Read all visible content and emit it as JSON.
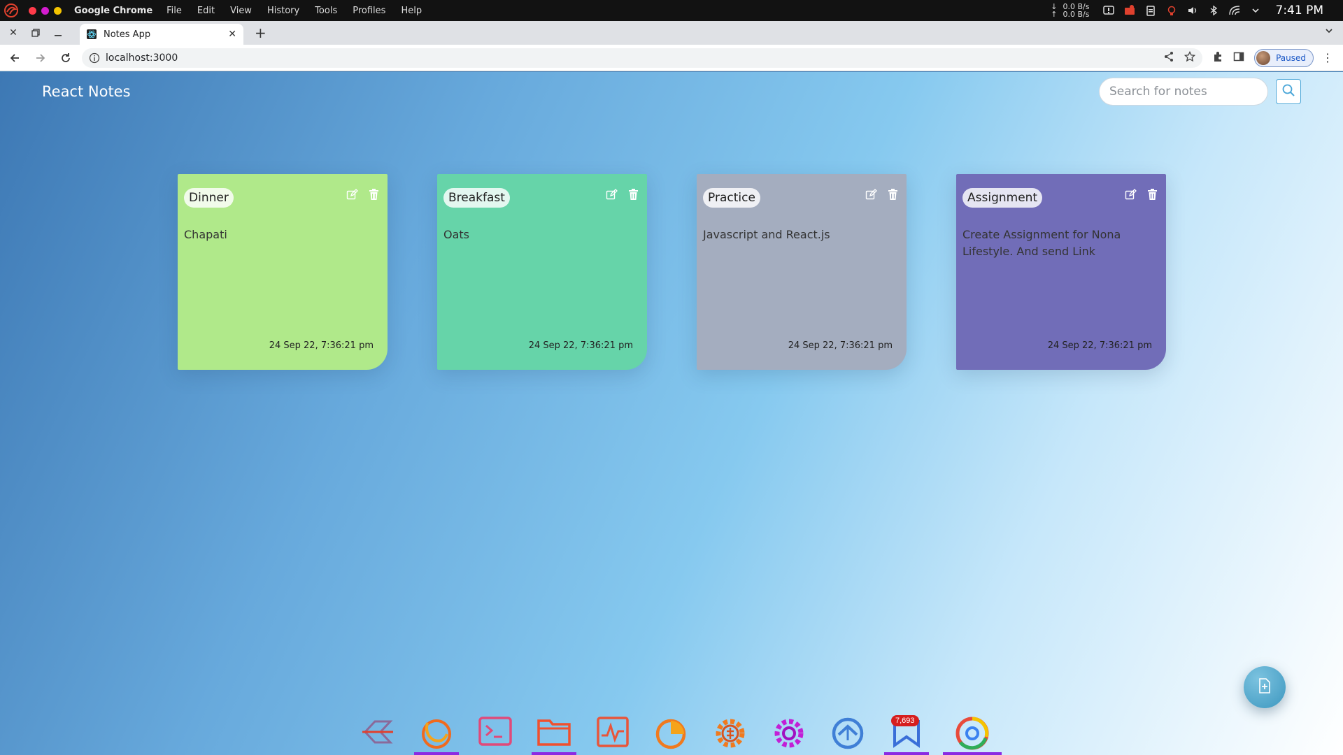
{
  "os": {
    "app_name": "Google Chrome",
    "menu": [
      "File",
      "Edit",
      "View",
      "History",
      "Tools",
      "Profiles",
      "Help"
    ],
    "net_down": "0.0 B/s",
    "net_up": "0.0 B/s",
    "clock": "7:41 PM"
  },
  "browser": {
    "tab_title": "Notes App",
    "url": "localhost:3000",
    "profile_status": "Paused"
  },
  "app": {
    "title": "React Notes",
    "search_placeholder": "Search for notes"
  },
  "notes": [
    {
      "title": "Dinner",
      "body": "Chapati",
      "date": "24 Sep 22, 7:36:21 pm",
      "color": "#b0e98a"
    },
    {
      "title": "Breakfast",
      "body": "Oats",
      "date": "24 Sep 22, 7:36:21 pm",
      "color": "#66d4a9"
    },
    {
      "title": "Practice",
      "body": "Javascript and React.js",
      "date": "24 Sep 22, 7:36:21 pm",
      "color": "#a4adbf"
    },
    {
      "title": "Assignment",
      "body": "Create Assignment for Nona Lifestyle. And send Link",
      "date": "24 Sep 22, 7:36:21 pm",
      "color": "#716db8"
    }
  ],
  "dock": {
    "items": [
      "zorin-icon",
      "firefox-icon",
      "terminal-icon",
      "files-icon",
      "system-monitor-icon",
      "disk-usage-icon",
      "settings-gear-icon",
      "tweaks-icon",
      "timeshift-icon",
      "bookmarks-icon",
      "chrome-icon"
    ],
    "badge": "7,693"
  },
  "colors": {
    "accent": "#4aa6d8",
    "indicator": "#8a2be2"
  }
}
